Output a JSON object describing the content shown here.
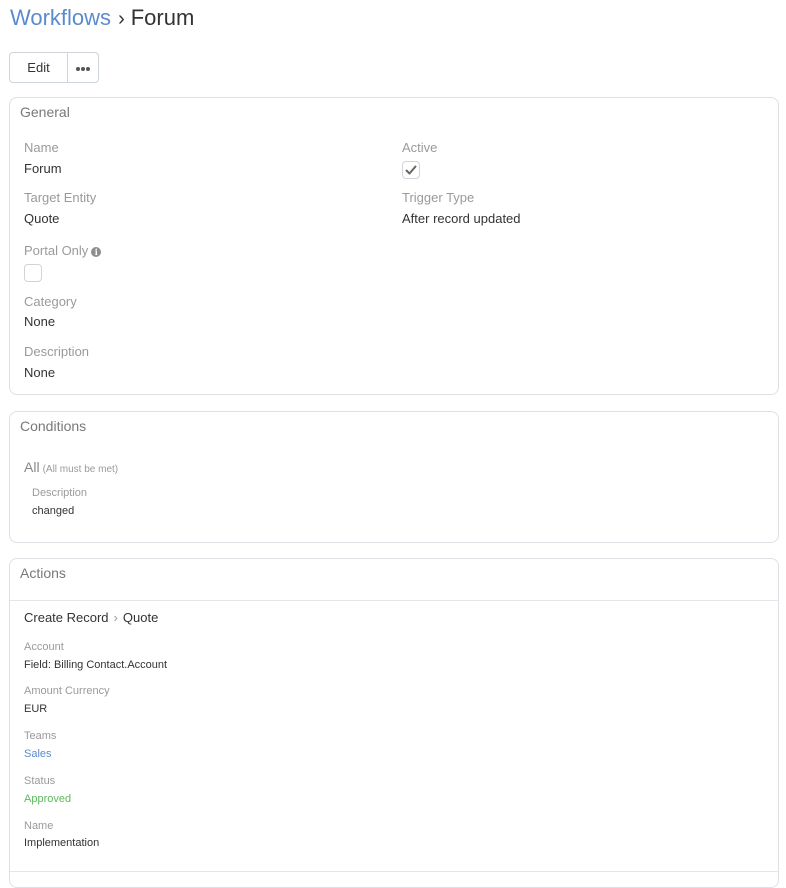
{
  "breadcrumb": {
    "parent": "Workflows",
    "separator": "›",
    "current": "Forum"
  },
  "toolbar": {
    "edit_label": "Edit",
    "more_icon": "ellipsis-icon"
  },
  "general": {
    "title": "General",
    "name_label": "Name",
    "name_value": "Forum",
    "active_label": "Active",
    "active_checked": true,
    "target_entity_label": "Target Entity",
    "target_entity_value": "Quote",
    "trigger_type_label": "Trigger Type",
    "trigger_type_value": "After record updated",
    "portal_only_label": "Portal Only",
    "portal_only_checked": false,
    "category_label": "Category",
    "category_value": "None",
    "description_label": "Description",
    "description_value": "None"
  },
  "conditions": {
    "title": "Conditions",
    "all_label": "All",
    "all_note": "(All must be met)",
    "field_label": "Description",
    "field_value": "changed"
  },
  "actions": {
    "title": "Actions",
    "action_type": "Create Record",
    "action_chevron": "›",
    "action_entity": "Quote",
    "fields": {
      "account_label": "Account",
      "account_value": "Field: Billing Contact.Account",
      "amount_currency_label": "Amount Currency",
      "amount_currency_value": "EUR",
      "teams_label": "Teams",
      "teams_value": "Sales",
      "status_label": "Status",
      "status_value": "Approved",
      "name_label": "Name",
      "name_value": "Implementation"
    }
  },
  "colors": {
    "link": "#5b8bcf",
    "status_approved": "#5cb85c"
  }
}
